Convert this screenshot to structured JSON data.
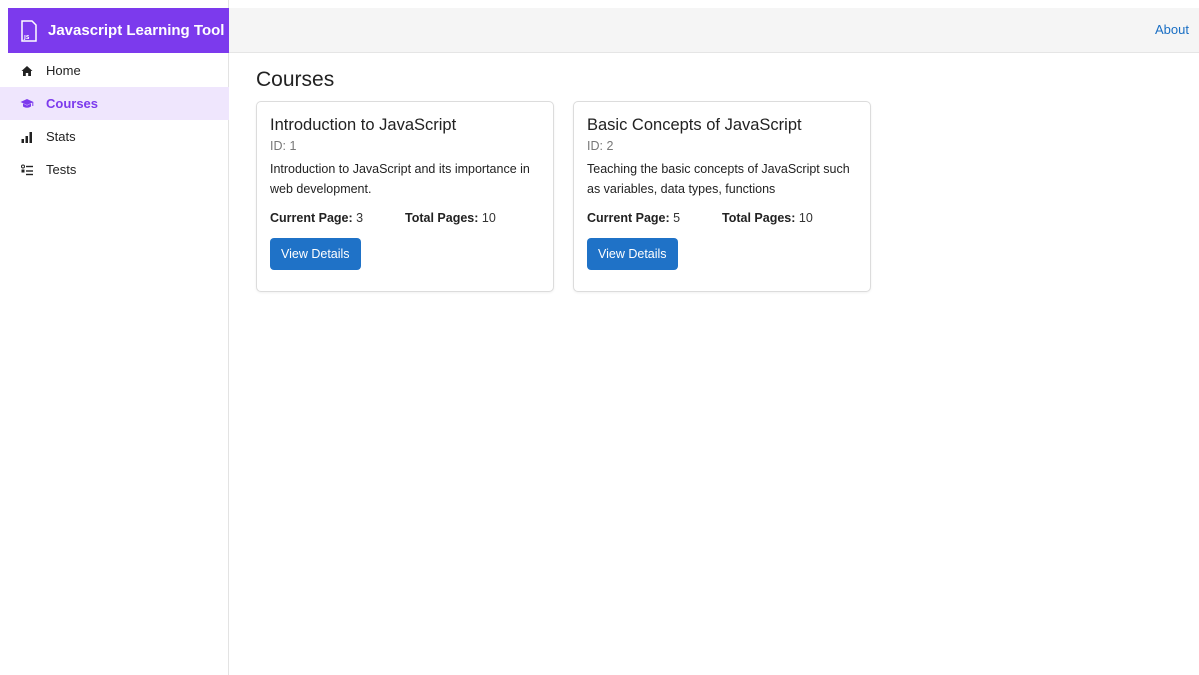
{
  "app": {
    "title": "Javascript Learning Tool",
    "accent_color": "#7c3aed",
    "link_color": "#1a6fc4",
    "button_color": "#1f72c7"
  },
  "topbar": {
    "about_label": "About"
  },
  "sidebar": {
    "items": [
      {
        "label": "Home",
        "icon": "home-icon",
        "active": false
      },
      {
        "label": "Courses",
        "icon": "graduation-cap-icon",
        "active": true
      },
      {
        "label": "Stats",
        "icon": "bar-chart-icon",
        "active": false
      },
      {
        "label": "Tests",
        "icon": "checklist-icon",
        "active": false
      }
    ]
  },
  "main": {
    "title": "Courses",
    "courses": [
      {
        "title": "Introduction to JavaScript",
        "id_text": "ID: 1",
        "description": "Introduction to JavaScript and its importance in web development.",
        "current_page_label": "Current Page:",
        "current_page": "3",
        "total_pages_label": "Total Pages:",
        "total_pages": "10",
        "button_label": "View Details"
      },
      {
        "title": "Basic Concepts of JavaScript",
        "id_text": "ID: 2",
        "description": "Teaching the basic concepts of JavaScript such as variables, data types, functions",
        "current_page_label": "Current Page:",
        "current_page": "5",
        "total_pages_label": "Total Pages:",
        "total_pages": "10",
        "button_label": "View Details"
      }
    ]
  }
}
